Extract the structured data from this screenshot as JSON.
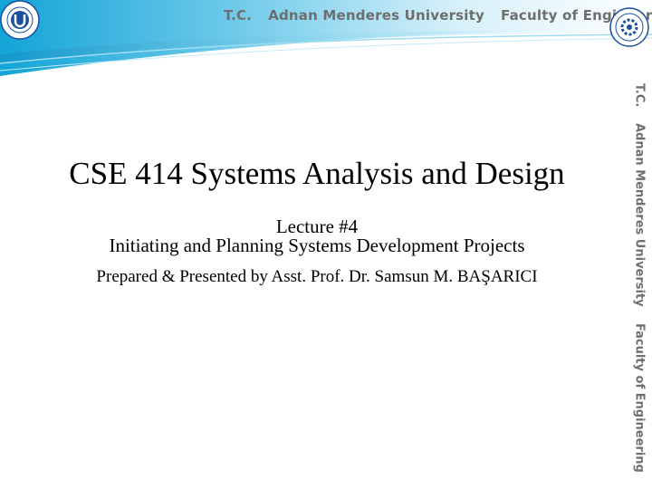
{
  "header": {
    "institution": "T.C.",
    "university": "Adnan Menderes University",
    "faculty": "Faculty of Engineering"
  },
  "side_banner": {
    "institution": "T.C.",
    "university": "Adnan Menderes University",
    "faculty": "Faculty of Engineering"
  },
  "slide": {
    "course_title": "CSE 414 Systems Analysis and Design",
    "lecture": "Lecture #4",
    "subtitle": "Initiating and Planning Systems Development Projects",
    "presenter": "Prepared & Presented by Asst. Prof. Dr. Samsun M. BAŞARICI"
  },
  "colors": {
    "header_blue": "#1aa9d8",
    "header_light": "#c9ecf7",
    "banner_text": "#6e6e6e",
    "logo_blue": "#1c4f9c"
  },
  "icons": {
    "left_logo": "adnan-menderes-university-seal",
    "right_logo": "engineering-faculty-seal"
  }
}
